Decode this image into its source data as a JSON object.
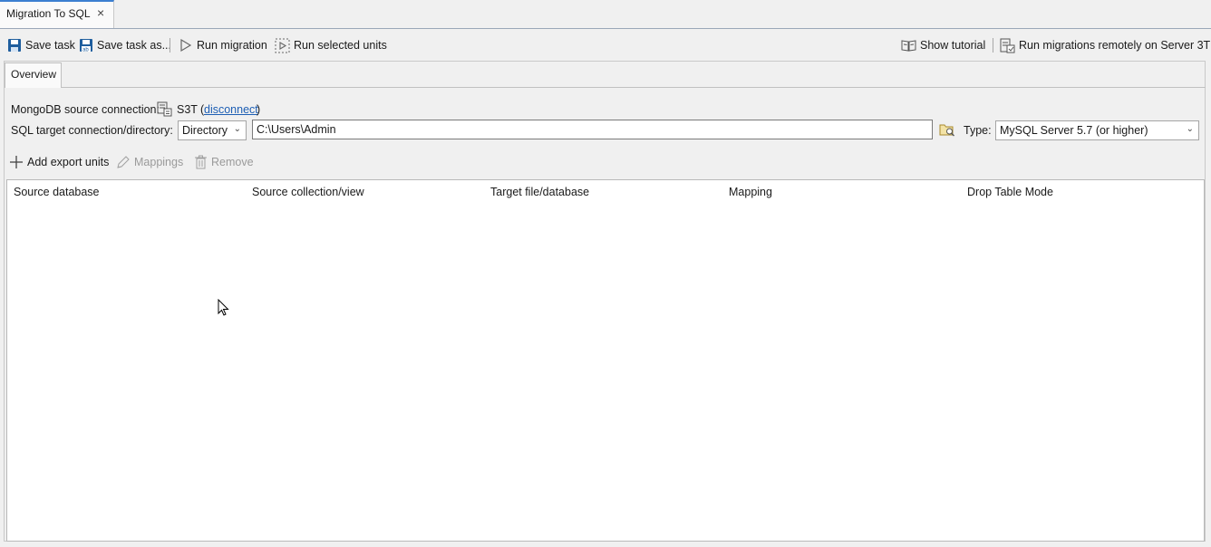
{
  "tab": {
    "title": "Migration To SQL",
    "close": "×"
  },
  "toolbar": {
    "save_task": "Save task",
    "save_task_as": "Save task as...",
    "run_migration": "Run migration",
    "run_selected_units": "Run selected units",
    "show_tutorial": "Show tutorial",
    "run_remote": "Run migrations remotely on Server 3T"
  },
  "subtabs": {
    "overview": "Overview"
  },
  "source": {
    "label": "MongoDB source connection:",
    "connection_name": "S3T",
    "open_paren": "(",
    "disconnect": "disconnect",
    "close_paren": ")"
  },
  "target": {
    "label": "SQL target connection/directory:",
    "mode_selected": "Directory",
    "path_value": "C:\\Users\\Admin",
    "type_label": "Type:",
    "type_selected": "MySQL Server 5.7 (or higher)"
  },
  "actions": {
    "add_export_units": "Add export units",
    "mappings": "Mappings",
    "remove": "Remove"
  },
  "table": {
    "columns": [
      "Source database",
      "Source collection/view",
      "Target file/database",
      "Mapping",
      "Drop Table Mode"
    ],
    "rows": []
  },
  "colors": {
    "accent": "#1e5fb4",
    "tab_accent": "#3c7fd1",
    "disk_blue": "#1f5e9e"
  },
  "icons": [
    "save-icon",
    "save-as-icon",
    "play-icon",
    "run-selected-icon",
    "book-icon",
    "server-run-icon",
    "database-connection-icon",
    "folder-browse-icon",
    "plus-icon",
    "pencil-icon",
    "trash-icon",
    "mouse-cursor-icon"
  ]
}
